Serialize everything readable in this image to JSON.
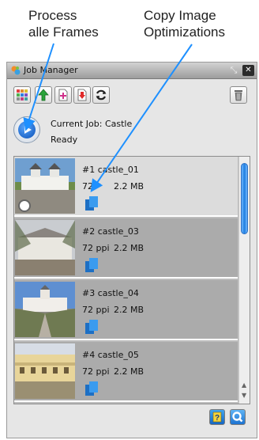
{
  "annotations": {
    "process": [
      "Process",
      "alle Frames"
    ],
    "copy": [
      "Copy Image",
      "Optimizations"
    ]
  },
  "panel": {
    "title": "Job Manager",
    "collapse_symbol": "⤡",
    "close_symbol": "✕"
  },
  "toolbar": {
    "buttons": [
      {
        "icon": "grid-icon"
      },
      {
        "icon": "green-arrow-up-icon"
      },
      {
        "icon": "add-doc-icon"
      },
      {
        "icon": "download-doc-icon"
      },
      {
        "icon": "refresh-icon"
      },
      {
        "icon": "trash-icon"
      }
    ]
  },
  "job": {
    "current_label": "Current Job: Castle",
    "status": "Ready"
  },
  "items": [
    {
      "name": "#1 castle_01",
      "ppi": "72",
      "size": "2.2 MB",
      "selected": true
    },
    {
      "name": "#2 castle_03",
      "ppi": "72 ppi",
      "size": "2.2 MB",
      "selected": false
    },
    {
      "name": "#3 castle_04",
      "ppi": "72 ppi",
      "size": "2.2 MB",
      "selected": false
    },
    {
      "name": "#4 castle_05",
      "ppi": "72 ppi",
      "size": "2.2 MB",
      "selected": false
    }
  ],
  "colors": {
    "accent_blue": "#1a7fe0",
    "arrow_blue": "#1e90ff",
    "panel_bg": "#e6e6e6",
    "row_selected": "#dcdcdc",
    "row_normal": "#ababab"
  }
}
